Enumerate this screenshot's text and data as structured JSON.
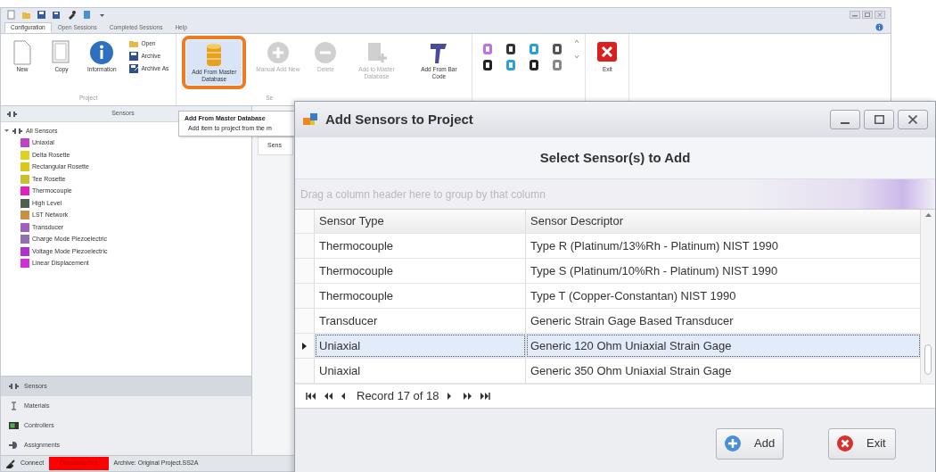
{
  "window": {
    "tabs": [
      {
        "label": "Configuration",
        "selected": true
      },
      {
        "label": "Open Sessions",
        "selected": false
      },
      {
        "label": "Completed Sessions",
        "selected": false
      },
      {
        "label": "Help",
        "selected": false
      }
    ]
  },
  "ribbon": {
    "groups": [
      {
        "label": "Project",
        "buttons": [
          {
            "kind": "large",
            "label": "New",
            "disabled": false
          },
          {
            "kind": "large",
            "label": "Copy",
            "disabled": false
          },
          {
            "kind": "large",
            "label": "Information",
            "disabled": false
          },
          {
            "kind": "stack",
            "items": [
              {
                "label": "Open"
              },
              {
                "label": "Archive"
              },
              {
                "label": "Archive As"
              }
            ]
          }
        ]
      },
      {
        "label": "Se",
        "buttons": [
          {
            "kind": "large",
            "label": "Add From Master Database",
            "disabled": false,
            "highlighted": true
          },
          {
            "kind": "large",
            "label": "Manual Add New",
            "disabled": true
          },
          {
            "kind": "large",
            "label": "Delete",
            "disabled": true
          },
          {
            "kind": "large",
            "label": "Add to Master Database",
            "disabled": true
          },
          {
            "kind": "large",
            "label": "Add From Bar Code",
            "disabled": false
          }
        ]
      },
      {
        "buttons": [
          {
            "kind": "gallery"
          }
        ]
      },
      {
        "buttons": [
          {
            "kind": "large",
            "label": "Exit",
            "disabled": false
          }
        ]
      }
    ]
  },
  "tooltip": {
    "title": "Add From Master Database",
    "text": "Add item to project from the m"
  },
  "sensors_panel": {
    "title": "Sensors",
    "tree": {
      "label": "All Sensors",
      "expanded": true,
      "children": [
        {
          "label": "Uniaxial",
          "color": "#c040c8"
        },
        {
          "label": "Delta Rosette",
          "color": "#e0d020"
        },
        {
          "label": "Rectangular Rosette",
          "color": "#d8c818"
        },
        {
          "label": "Tee Rosette",
          "color": "#c8c030"
        },
        {
          "label": "Thermocouple",
          "color": "#e020c0"
        },
        {
          "label": "High Level",
          "color": "#506050"
        },
        {
          "label": "LST Network",
          "color": "#c89040"
        },
        {
          "label": "Transducer",
          "color": "#a060c0"
        },
        {
          "label": "Charge Mode Piezoelectric",
          "color": "#9070b0"
        },
        {
          "label": "Voltage Mode Piezoelectric",
          "color": "#b030d0"
        },
        {
          "label": "Linear Displacement",
          "color": "#d030d8"
        }
      ]
    }
  },
  "middle_panel": {
    "column_1": "Sens"
  },
  "navigation": [
    {
      "label": "Sensors",
      "selected": true
    },
    {
      "label": "Materials",
      "selected": false
    },
    {
      "label": "Controllers",
      "selected": false
    },
    {
      "label": "Assignments",
      "selected": false
    }
  ],
  "status_bar": {
    "connect": "Connect",
    "connection": "Disconnected",
    "archive": "Archive: Original Project.SS2A"
  },
  "dialog": {
    "title": "Add Sensors to Project",
    "heading": "Select Sensor(s) to Add",
    "group_panel": "Drag a column header here to group by that column",
    "columns": [
      "Sensor Type",
      "Sensor Descriptor"
    ],
    "rows": [
      {
        "cells": [
          "Thermocouple",
          "Type R (Platinum/13%Rh - Platinum) NIST 1990"
        ],
        "selected": false
      },
      {
        "cells": [
          "Thermocouple",
          "Type S (Platinum/10%Rh - Platinum) NIST 1990"
        ],
        "selected": false
      },
      {
        "cells": [
          "Thermocouple",
          "Type T (Copper-Constantan) NIST 1990"
        ],
        "selected": false
      },
      {
        "cells": [
          "Transducer",
          "Generic Strain Gage Based Transducer"
        ],
        "selected": false
      },
      {
        "cells": [
          "Uniaxial",
          "Generic 120 Ohm Uniaxial Strain Gage"
        ],
        "selected": true
      },
      {
        "cells": [
          "Uniaxial",
          "Generic 350 Ohm Uniaxial Strain Gage"
        ],
        "selected": false
      }
    ],
    "record": "Record 17 of 18",
    "buttons": [
      {
        "label": "Add",
        "kind": "add"
      },
      {
        "label": "Exit",
        "kind": "exit"
      }
    ]
  }
}
